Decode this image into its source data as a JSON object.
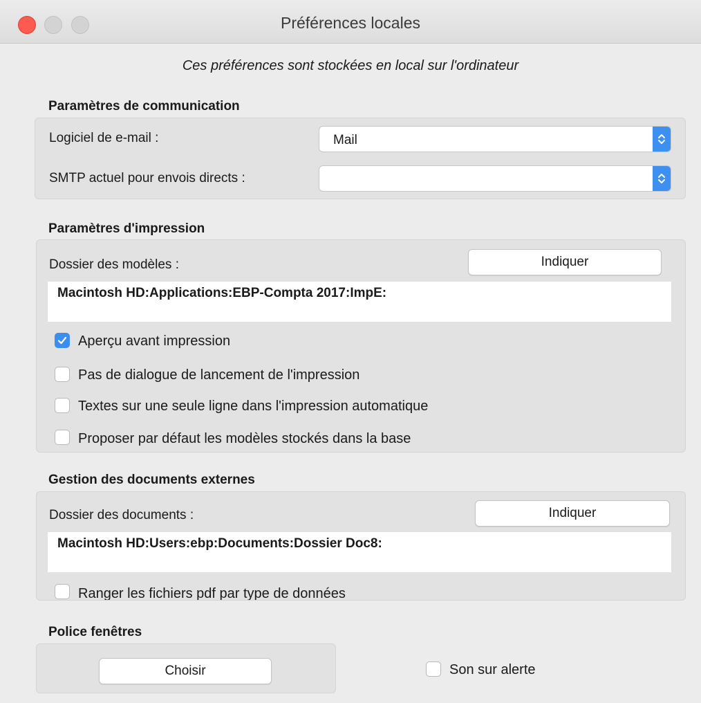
{
  "window": {
    "title": "Préférences locales"
  },
  "subtitle": "Ces préférences sont stockées en local sur l'ordinateur",
  "communication": {
    "title": "Paramètres de communication",
    "email_label": "Logiciel de e-mail :",
    "email_value": "Mail",
    "smtp_label": "SMTP actuel pour envois directs :",
    "smtp_value": ""
  },
  "printing": {
    "title": "Paramètres d'impression",
    "folder_label": "Dossier des modèles :",
    "indicate_label": "Indiquer",
    "folder_path": "Macintosh HD:Applications:EBP-Compta 2017:ImpE:",
    "options": [
      {
        "label": "Aperçu avant impression",
        "checked": true
      },
      {
        "label": "Pas de dialogue de lancement de l'impression",
        "checked": false
      },
      {
        "label": "Textes sur une seule ligne dans l'impression automatique",
        "checked": false
      },
      {
        "label": "Proposer par défaut les modèles stockés dans la base",
        "checked": false
      }
    ]
  },
  "external_docs": {
    "title": "Gestion des documents externes",
    "folder_label": "Dossier des documents :",
    "indicate_label": "Indiquer",
    "folder_path": "Macintosh HD:Users:ebp:Documents:Dossier Doc8:",
    "options": [
      {
        "label": "Ranger les fichiers pdf par type de données",
        "checked": false
      }
    ]
  },
  "font": {
    "title": "Police fenêtres",
    "choose_label": "Choisir",
    "sound_label": "Son sur alerte",
    "sound_checked": false
  },
  "colors": {
    "accent": "#3b8ef1",
    "close": "#fd5a52"
  }
}
